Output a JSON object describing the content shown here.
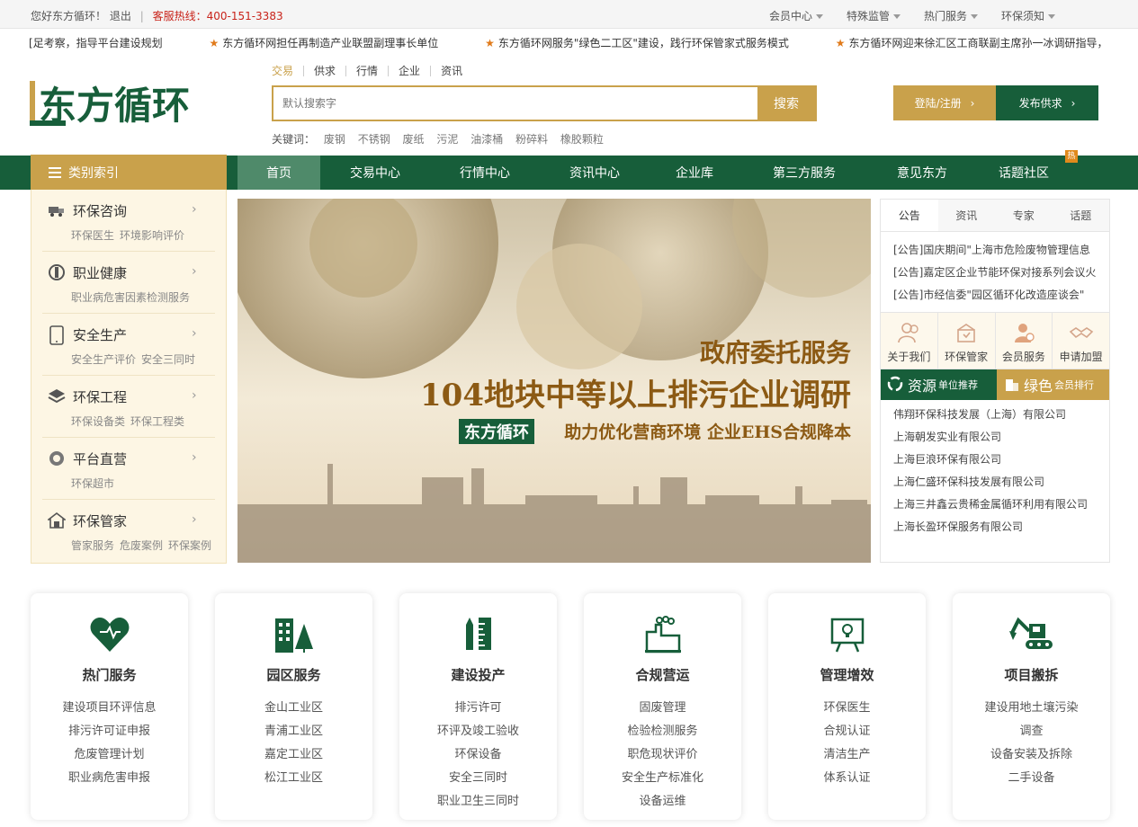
{
  "topbar": {
    "greeting": "您好东方循环！",
    "logout": "退出",
    "hotline_label": "客服热线：",
    "hotline": "400-151-3383",
    "menus": [
      "会员中心",
      "特殊监管",
      "热门服务",
      "环保须知"
    ]
  },
  "ticker": [
    "[足考察，指导平台建设规划",
    "东方循环网担任再制造产业联盟副理事长单位",
    "东方循环网服务\"绿色二工区\"建设，践行环保管家式服务模式",
    "东方循环网迎来徐汇区工商联副主席孙一冰调研指导，"
  ],
  "logo_text": "东方循环",
  "search": {
    "tabs": [
      "交易",
      "供求",
      "行情",
      "企业",
      "资讯"
    ],
    "placeholder": "默认搜索字",
    "button": "搜索",
    "keywords_label": "关键词：",
    "keywords": [
      "废钢",
      "不锈钢",
      "废纸",
      "污泥",
      "油漆桶",
      "粉碎料",
      "橡胶颗粒"
    ]
  },
  "header_buttons": {
    "register": "登陆/注册",
    "publish": "发布供求"
  },
  "nav": {
    "category_label": "类别索引",
    "items": [
      "首页",
      "交易中心",
      "行情中心",
      "资讯中心",
      "企业库",
      "第三方服务",
      "意见东方",
      "话题社区"
    ],
    "hot_badge": "热"
  },
  "categories": [
    {
      "title": "环保咨询",
      "icon": "truck-icon",
      "subs": [
        "环保医生",
        "环境影响评价"
      ]
    },
    {
      "title": "职业健康",
      "icon": "disc-icon",
      "subs": [
        "职业病危害因素检测服务"
      ]
    },
    {
      "title": "安全生产",
      "icon": "tablet-icon",
      "subs": [
        "安全生产评价",
        "安全三同时"
      ]
    },
    {
      "title": "环保工程",
      "icon": "layers-icon",
      "subs": [
        "环保设备类",
        "环保工程类"
      ]
    },
    {
      "title": "平台直营",
      "icon": "coin-icon",
      "subs": [
        "环保超市"
      ]
    },
    {
      "title": "环保管家",
      "icon": "house-icon",
      "subs": [
        "管家服务",
        "危废案例",
        "环保案例"
      ]
    }
  ],
  "banner": {
    "line1": "政府委托服务",
    "line2": "104地块中等以上排污企业调研",
    "line3": "助力优化营商环境 企业EHS合规降本",
    "logo": "东方循环"
  },
  "right_panel": {
    "tabs": [
      "公告",
      "资讯",
      "专家",
      "话题"
    ],
    "notices": [
      "[公告]国庆期间\"上海市危险废物管理信息",
      "[公告]嘉定区企业节能环保对接系列会议火",
      "[公告]市经信委\"园区循环化改造座谈会\""
    ],
    "quick_links": [
      "关于我们",
      "环保管家",
      "会员服务",
      "申请加盟"
    ],
    "rank_a": {
      "big": "资源",
      "small": "单位推荐"
    },
    "rank_b": {
      "big": "绿色",
      "small": "会员排行"
    },
    "companies": [
      "伟翔环保科技发展（上海）有限公司",
      "上海朝发实业有限公司",
      "上海巨浪环保有限公司",
      "上海仁盛环保科技发展有限公司",
      "上海三井鑫云贵稀金属循环利用有限公司",
      "上海长盈环保服务有限公司"
    ]
  },
  "cards": [
    {
      "title": "热门服务",
      "icon": "heart-icon",
      "items": [
        "建设项目环评信息",
        "排污许可证申报",
        "危废管理计划",
        "职业病危害申报"
      ]
    },
    {
      "title": "园区服务",
      "icon": "buildings-icon",
      "items": [
        "金山工业区",
        "青浦工业区",
        "嘉定工业区",
        "松江工业区"
      ]
    },
    {
      "title": "建设投产",
      "icon": "pen-ruler-icon",
      "items": [
        "排污许可",
        "环评及竣工验收",
        "环保设备",
        "安全三同时",
        "职业卫生三同时"
      ]
    },
    {
      "title": "合规营运",
      "icon": "factory-icon",
      "items": [
        "固废管理",
        "检验检测服务",
        "职危现状评价",
        "安全生产标准化",
        "设备运维"
      ]
    },
    {
      "title": "管理增效",
      "icon": "presentation-icon",
      "items": [
        "环保医生",
        "合规认证",
        "清洁生产",
        "体系认证"
      ]
    },
    {
      "title": "项目搬拆",
      "icon": "excavator-icon",
      "items": [
        "建设用地土壤污染",
        "调查",
        "设备安装及拆除",
        "二手设备"
      ]
    }
  ],
  "colors": {
    "green": "#175e3a",
    "gold": "#c9a14b",
    "red": "#c8231a"
  }
}
